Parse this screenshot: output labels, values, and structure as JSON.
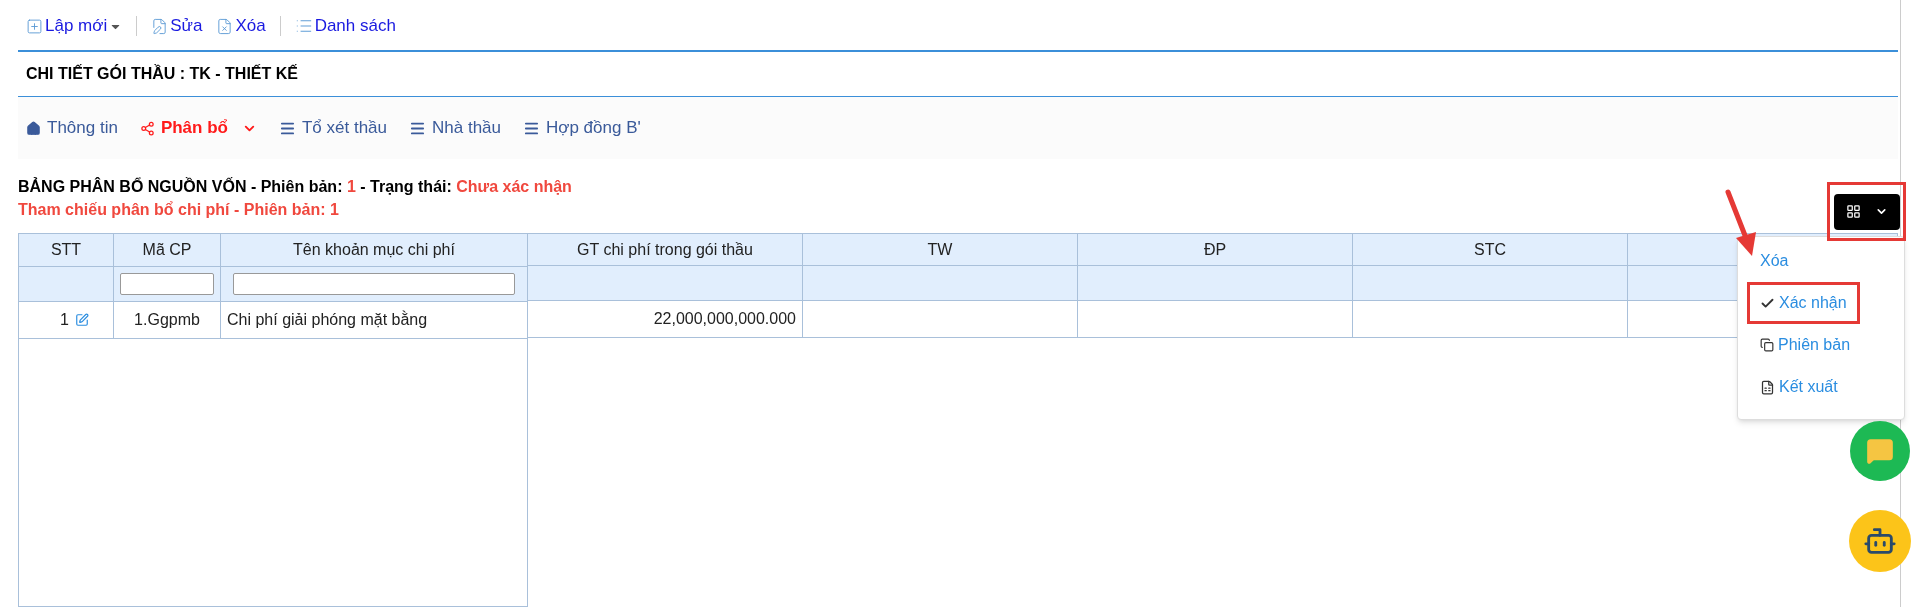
{
  "toolbar": [
    {
      "kind": "new",
      "label": "Lập mới",
      "dropdown": true
    },
    {
      "kind": "edit",
      "label": "Sửa",
      "dropdown": false
    },
    {
      "kind": "delete",
      "label": "Xóa",
      "dropdown": false
    },
    {
      "kind": "list",
      "label": "Danh sách",
      "dropdown": false
    }
  ],
  "page_title": "CHI TIẾT GÓI THẦU : TK - THIẾT KẾ",
  "tabs": [
    {
      "kind": "home",
      "label": "Thông tin",
      "selected": false,
      "dropdown": false
    },
    {
      "kind": "share",
      "label": "Phân bổ",
      "selected": true,
      "dropdown": true
    },
    {
      "kind": "list",
      "label": "Tổ xét thầu",
      "selected": false,
      "dropdown": false
    },
    {
      "kind": "list",
      "label": "Nhà thầu",
      "selected": false,
      "dropdown": false
    },
    {
      "kind": "list",
      "label": "Hợp đồng B'",
      "selected": false,
      "dropdown": false
    }
  ],
  "heading": [
    {
      "text": "BẢNG PHÂN BỔ NGUỒN VỐN - Phiên bản: ",
      "highlight": false
    },
    {
      "text": "1",
      "highlight": true
    },
    {
      "text": " - Trạng thái: ",
      "highlight": false
    },
    {
      "text": "Chưa xác nhận",
      "highlight": true
    }
  ],
  "reference": "Tham chiếu phân bổ chi phí - Phiên bản: 1",
  "table": {
    "left_columns": [
      "STT",
      "Mã CP",
      "Tên khoản mục chi phí"
    ],
    "right_columns": [
      "GT chi phí trong gói thầu",
      "TW",
      "ĐP",
      "STC"
    ],
    "rows": [
      {
        "stt": "1",
        "code": "1.Ggpmb",
        "name": "Chi phí giải phóng mặt bằng",
        "value": "22,000,000,000.000"
      }
    ]
  },
  "actions_menu": {
    "highlighted": true,
    "items": [
      {
        "kind": "delete",
        "label": "Xóa",
        "highlighted": false
      },
      {
        "kind": "confirm",
        "label": "Xác nhận",
        "highlighted": true
      },
      {
        "kind": "version",
        "label": "Phiên bản",
        "highlighted": false
      },
      {
        "kind": "export",
        "label": "Kết xuất",
        "highlighted": false
      }
    ]
  }
}
